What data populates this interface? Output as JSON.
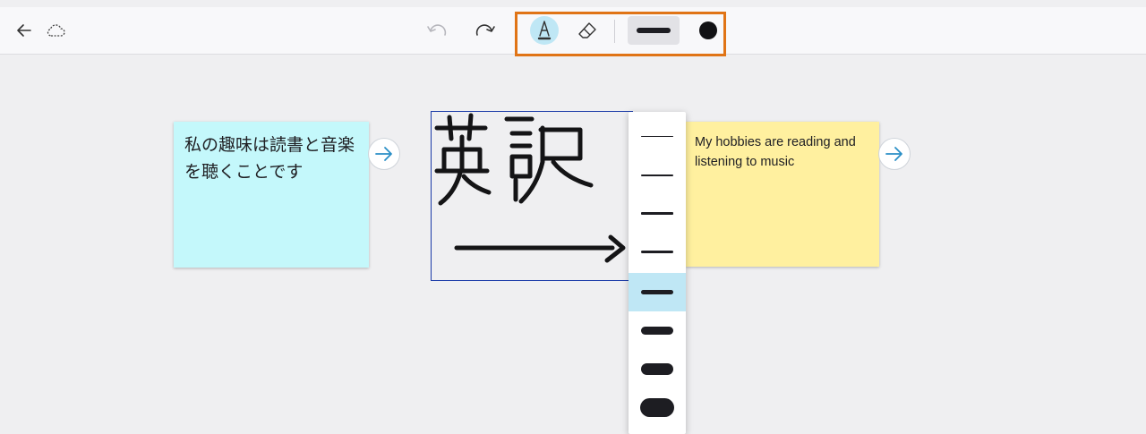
{
  "toolbar": {
    "back_icon": "arrow-left-icon",
    "cloud_icon": "cloud-icon",
    "undo_icon": "undo-icon",
    "redo_icon": "redo-icon",
    "pen_icon": "pen-tool-icon",
    "eraser_icon": "eraser-icon",
    "highlight_color": "#e07416",
    "current_ink_color": "#111114"
  },
  "notes": [
    {
      "text": "私の趣味は読書と音楽を聴くことです",
      "color": "#c4f8fb"
    },
    {
      "text": "My hobbies are reading and listening to music",
      "color": "#fff09f"
    }
  ],
  "thickness_menu": {
    "options": [
      1,
      2,
      3,
      4,
      5,
      6,
      7,
      8
    ],
    "selected_index": 4
  }
}
